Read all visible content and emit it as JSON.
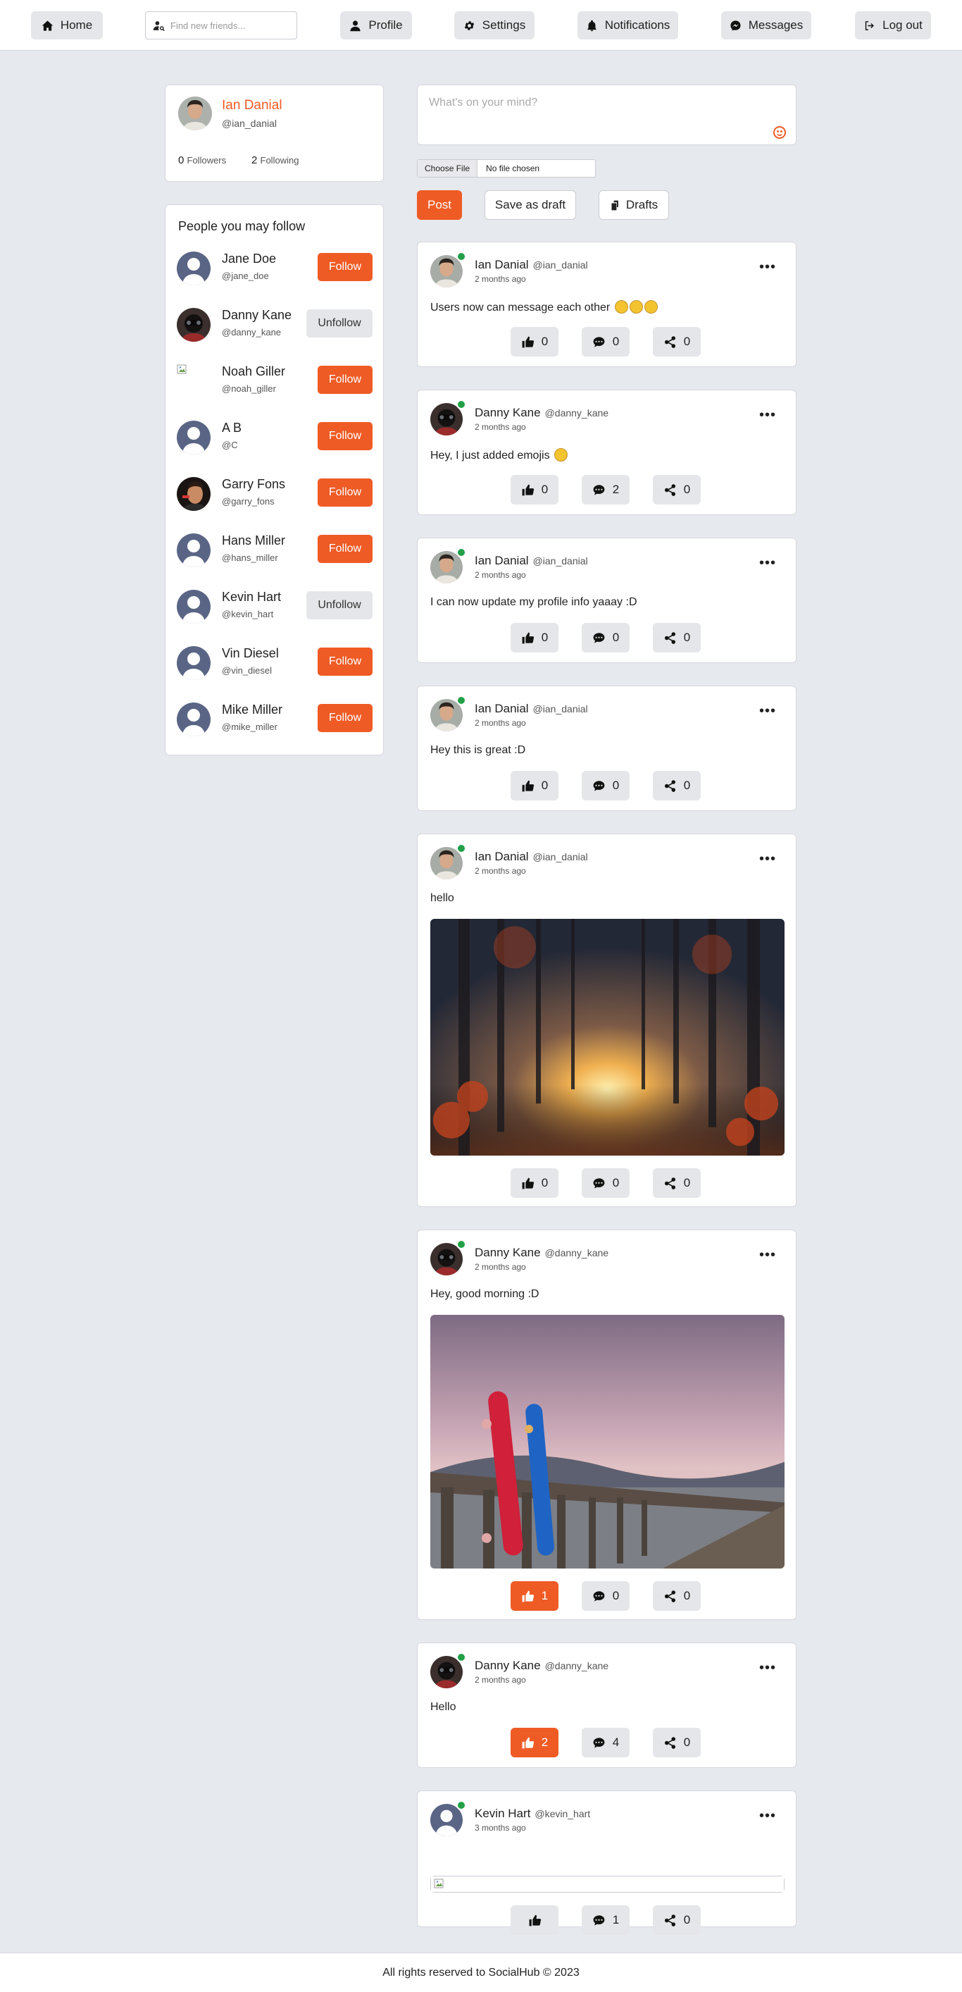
{
  "nav": {
    "home": "Home",
    "search_placeholder": "Find new friends...",
    "profile": "Profile",
    "settings": "Settings",
    "notifications": "Notifications",
    "messages": "Messages",
    "logout": "Log out"
  },
  "profile_card": {
    "name": "Ian Danial",
    "handle": "@ian_danial",
    "followers_count": "0",
    "followers_label": "Followers",
    "following_count": "2",
    "following_label": "Following"
  },
  "suggestions": {
    "title": "People you may follow",
    "items": [
      {
        "name": "Jane Doe",
        "handle": "@jane_doe",
        "button": "Follow",
        "state": "follow",
        "avatar": "default"
      },
      {
        "name": "Danny Kane",
        "handle": "@danny_kane",
        "button": "Unfollow",
        "state": "unfollow",
        "avatar": "danny"
      },
      {
        "name": "Noah Giller",
        "handle": "@noah_giller",
        "button": "Follow",
        "state": "follow",
        "avatar": "broken"
      },
      {
        "name": "A B",
        "handle": "@C",
        "button": "Follow",
        "state": "follow",
        "avatar": "default"
      },
      {
        "name": "Garry Fons",
        "handle": "@garry_fons",
        "button": "Follow",
        "state": "follow",
        "avatar": "garry"
      },
      {
        "name": "Hans Miller",
        "handle": "@hans_miller",
        "button": "Follow",
        "state": "follow",
        "avatar": "default"
      },
      {
        "name": "Kevin Hart",
        "handle": "@kevin_hart",
        "button": "Unfollow",
        "state": "unfollow",
        "avatar": "default"
      },
      {
        "name": "Vin Diesel",
        "handle": "@vin_diesel",
        "button": "Follow",
        "state": "follow",
        "avatar": "default"
      },
      {
        "name": "Mike Miller",
        "handle": "@mike_miller",
        "button": "Follow",
        "state": "follow",
        "avatar": "default"
      }
    ]
  },
  "composer": {
    "placeholder": "What's on your mind?",
    "choose_file": "Choose File",
    "no_file": "No file chosen",
    "post": "Post",
    "save_draft": "Save as draft",
    "drafts": "Drafts"
  },
  "posts": [
    {
      "name": "Ian Danial",
      "handle": "@ian_danial",
      "time": "2 months ago",
      "text": "Users now can message each other",
      "likes": "0",
      "comments": "0",
      "shares": "0"
    },
    {
      "name": "Danny Kane",
      "handle": "@danny_kane",
      "time": "2 months ago",
      "text": "Hey, I just added emojis",
      "likes": "0",
      "comments": "2",
      "shares": "0"
    },
    {
      "name": "Ian Danial",
      "handle": "@ian_danial",
      "time": "2 months ago",
      "text": "I can now update my profile info yaaay :D",
      "likes": "0",
      "comments": "0",
      "shares": "0"
    },
    {
      "name": "Ian Danial",
      "handle": "@ian_danial",
      "time": "2 months ago",
      "text": "Hey this is great :D",
      "likes": "0",
      "comments": "0",
      "shares": "0"
    },
    {
      "name": "Ian Danial",
      "handle": "@ian_danial",
      "time": "2 months ago",
      "text": "hello",
      "likes": "0",
      "comments": "0",
      "shares": "0"
    },
    {
      "name": "Danny Kane",
      "handle": "@danny_kane",
      "time": "2 months ago",
      "text": "Hey, good morning :D",
      "likes": "1",
      "comments": "0",
      "shares": "0"
    },
    {
      "name": "Danny Kane",
      "handle": "@danny_kane",
      "time": "2 months ago",
      "text": "Hello",
      "likes": "2",
      "comments": "4",
      "shares": "0"
    },
    {
      "name": "Kevin Hart",
      "handle": "@kevin_hart",
      "time": "3 months ago",
      "text": "",
      "likes": "",
      "comments": "1",
      "shares": "0"
    }
  ],
  "footer": "All rights reserved to SocialHub © 2023",
  "colors": {
    "accent": "#ef5b25",
    "online": "#22a048",
    "background": "#e6e9ee"
  }
}
